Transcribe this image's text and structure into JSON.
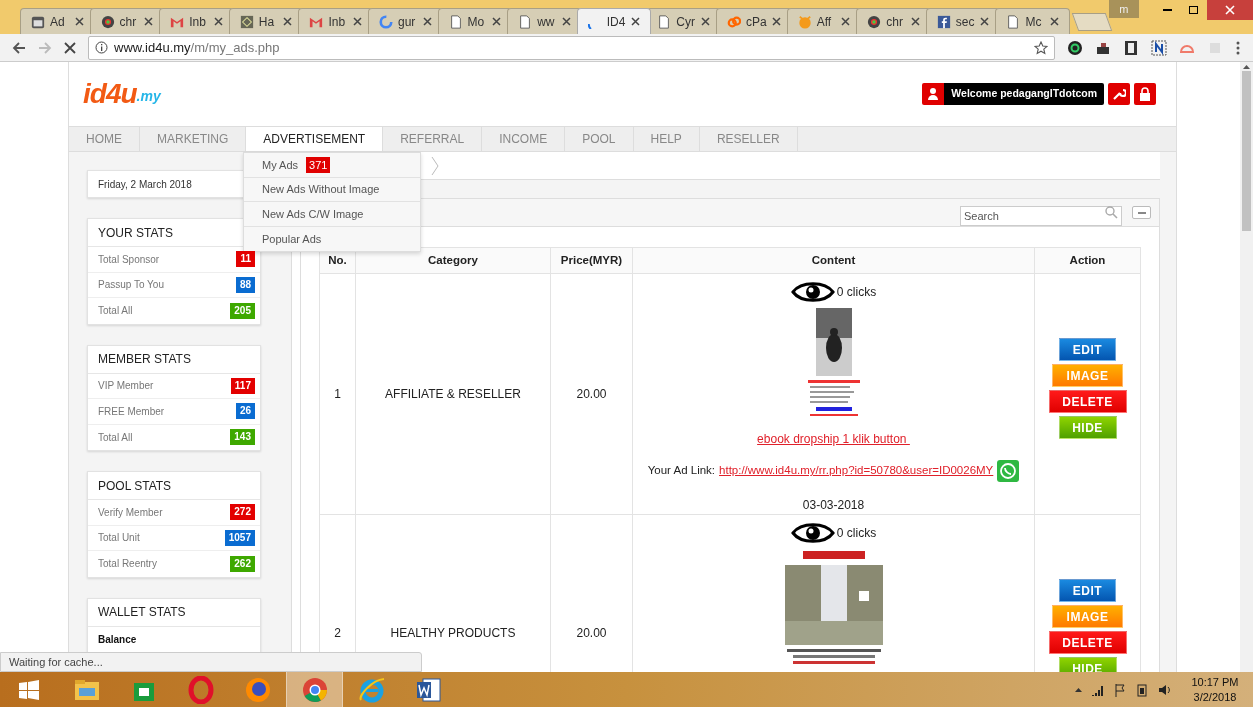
{
  "browser": {
    "tabs": [
      {
        "title": "Ad",
        "kind": "calendar",
        "selected": false
      },
      {
        "title": "chr",
        "kind": "chrome",
        "selected": false
      },
      {
        "title": "Inb",
        "kind": "gmail",
        "selected": false
      },
      {
        "title": "Ha",
        "kind": "diamond",
        "selected": false
      },
      {
        "title": "Inb",
        "kind": "gmail",
        "selected": false
      },
      {
        "title": "gur",
        "kind": "google",
        "selected": false
      },
      {
        "title": "Mo",
        "kind": "page",
        "selected": false
      },
      {
        "title": "ww",
        "kind": "page",
        "selected": false
      },
      {
        "title": "ID4",
        "kind": "loading",
        "selected": true
      },
      {
        "title": "Cyr",
        "kind": "page",
        "selected": false
      },
      {
        "title": "cPa",
        "kind": "cpanel",
        "selected": false
      },
      {
        "title": "Aff",
        "kind": "cat",
        "selected": false
      },
      {
        "title": "chr",
        "kind": "chrome",
        "selected": false
      },
      {
        "title": "sec",
        "kind": "facebook",
        "selected": false
      },
      {
        "title": "Mc",
        "kind": "page",
        "selected": false
      }
    ],
    "profile": "m",
    "url_host": "www.id4u.my",
    "url_path": "/m/my_ads.php",
    "status": "Waiting for cache..."
  },
  "site": {
    "logo": "id4u",
    "logo_suffix": ".my",
    "welcome": "Welcome pedagangITdotcom",
    "nav": [
      {
        "label": "HOME",
        "selected": false
      },
      {
        "label": "MARKETING",
        "selected": false
      },
      {
        "label": "ADVERTISEMENT",
        "selected": true
      },
      {
        "label": "REFERRAL",
        "selected": false
      },
      {
        "label": "INCOME",
        "selected": false
      },
      {
        "label": "POOL",
        "selected": false
      },
      {
        "label": "HELP",
        "selected": false
      },
      {
        "label": "RESELLER",
        "selected": false
      }
    ],
    "dropdown": [
      {
        "label": "My Ads",
        "badge": "371"
      },
      {
        "label": "New Ads Without Image"
      },
      {
        "label": "New Ads C/W Image"
      },
      {
        "label": "Popular Ads"
      }
    ],
    "date": "Friday, 2 March 2018",
    "stat_panels": [
      {
        "title": "YOUR STATS",
        "rows": [
          {
            "label": "Total Sponsor",
            "value": "11",
            "color": "#e30000"
          },
          {
            "label": "Passup To You",
            "value": "88",
            "color": "#0a6cd1"
          },
          {
            "label": "Total All",
            "value": "205",
            "color": "#3ea800"
          }
        ]
      },
      {
        "title": "MEMBER STATS",
        "rows": [
          {
            "label": "VIP Member",
            "value": "117",
            "color": "#e30000"
          },
          {
            "label": "FREE Member",
            "value": "26",
            "color": "#0a6cd1"
          },
          {
            "label": "Total All",
            "value": "143",
            "color": "#3ea800"
          }
        ]
      },
      {
        "title": "POOL STATS",
        "rows": [
          {
            "label": "Verify Member",
            "value": "272",
            "color": "#e30000"
          },
          {
            "label": "Total Unit",
            "value": "1057",
            "color": "#0a6cd1"
          },
          {
            "label": "Total Reentry",
            "value": "262",
            "color": "#3ea800"
          }
        ]
      },
      {
        "title": "WALLET STATS",
        "rows": [
          {
            "label": "Balance"
          }
        ]
      }
    ],
    "search_placeholder": "Search",
    "table": {
      "columns": [
        "No.",
        "Category",
        "Price(MYR)",
        "Content",
        "Action"
      ],
      "rows": [
        {
          "no": "1",
          "category": "AFFILIATE & RESELLER",
          "price": "20.00",
          "clicks": "0 clicks",
          "ad_title": "ebook dropship 1 klik button ",
          "link_label": "Your Ad Link:",
          "link": "http://www.id4u.my/rr.php?id=50780&user=ID0026MY",
          "date": "03-03-2018",
          "actions": [
            {
              "label": "EDIT",
              "kind": "edit"
            },
            {
              "label": "IMAGE"
            },
            {
              "label": "DELETE",
              "kind": "delete"
            },
            {
              "label": "HIDE",
              "kind": "hide"
            }
          ]
        },
        {
          "no": "2",
          "category": "HEALTHY PRODUCTS",
          "price": "20.00",
          "clicks": "0 clicks",
          "actions": [
            {
              "label": "EDIT",
              "kind": "edit"
            },
            {
              "label": "IMAGE"
            },
            {
              "label": "DELETE",
              "kind": "delete"
            },
            {
              "label": "HIDE",
              "kind": "hide"
            }
          ]
        }
      ]
    }
  },
  "taskbar": {
    "apps": [
      {
        "kind": "explorer",
        "selected": false
      },
      {
        "kind": "store",
        "selected": false
      },
      {
        "kind": "opera",
        "selected": false
      },
      {
        "kind": "firefox",
        "selected": false
      },
      {
        "kind": "chrome",
        "selected": true
      },
      {
        "kind": "ie",
        "selected": false
      },
      {
        "kind": "word",
        "selected": false
      }
    ],
    "time": "10:17 PM",
    "date": "3/2/2018"
  }
}
